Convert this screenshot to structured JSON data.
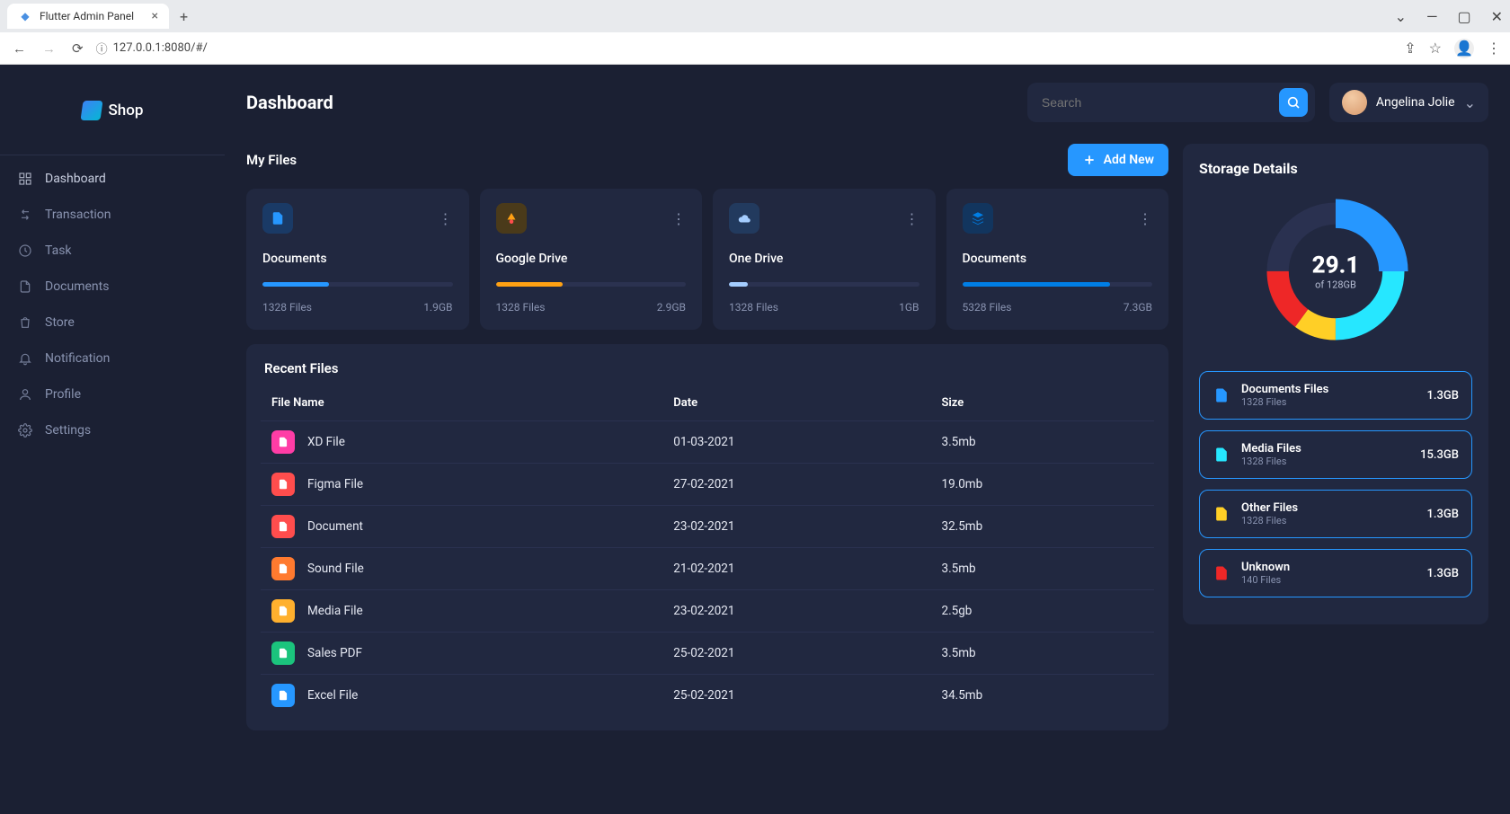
{
  "browser": {
    "tab_title": "Flutter Admin Panel",
    "url": "127.0.0.1:8080/#/"
  },
  "brand": "Shop",
  "nav": [
    {
      "label": "Dashboard",
      "icon": "grid"
    },
    {
      "label": "Transaction",
      "icon": "swap"
    },
    {
      "label": "Task",
      "icon": "clock"
    },
    {
      "label": "Documents",
      "icon": "file"
    },
    {
      "label": "Store",
      "icon": "bag"
    },
    {
      "label": "Notification",
      "icon": "bell"
    },
    {
      "label": "Profile",
      "icon": "user"
    },
    {
      "label": "Settings",
      "icon": "gear"
    }
  ],
  "header": {
    "title": "Dashboard",
    "search_placeholder": "Search",
    "user": "Angelina Jolie"
  },
  "myfiles": {
    "title": "My Files",
    "add_label": "Add New",
    "cards": [
      {
        "title": "Documents",
        "files": "1328 Files",
        "size": "1.9GB",
        "progress": 35,
        "color": "#2697ff",
        "bg": "#1a3a66"
      },
      {
        "title": "Google Drive",
        "files": "1328 Files",
        "size": "2.9GB",
        "progress": 35,
        "color": "#ffa113",
        "bg": "#4a3a1a"
      },
      {
        "title": "One Drive",
        "files": "1328 Files",
        "size": "1GB",
        "progress": 10,
        "color": "#a4cdff",
        "bg": "#223a5e"
      },
      {
        "title": "Documents",
        "files": "5328 Files",
        "size": "7.3GB",
        "progress": 78,
        "color": "#007ee5",
        "bg": "#12355e"
      }
    ]
  },
  "recent": {
    "title": "Recent Files",
    "headers": [
      "File Name",
      "Date",
      "Size"
    ],
    "rows": [
      {
        "name": "XD File",
        "date": "01-03-2021",
        "size": "3.5mb",
        "color": "#ff3da6"
      },
      {
        "name": "Figma File",
        "date": "27-02-2021",
        "size": "19.0mb",
        "color": "#ff4d4d"
      },
      {
        "name": "Document",
        "date": "23-02-2021",
        "size": "32.5mb",
        "color": "#ff4d4d"
      },
      {
        "name": "Sound File",
        "date": "21-02-2021",
        "size": "3.5mb",
        "color": "#ff7a2f"
      },
      {
        "name": "Media File",
        "date": "23-02-2021",
        "size": "2.5gb",
        "color": "#ffb02e"
      },
      {
        "name": "Sales PDF",
        "date": "25-02-2021",
        "size": "3.5mb",
        "color": "#1bc47d"
      },
      {
        "name": "Excel File",
        "date": "25-02-2021",
        "size": "34.5mb",
        "color": "#2697ff"
      }
    ]
  },
  "storage": {
    "title": "Storage Details",
    "center_value": "29.1",
    "center_sub": "of 128GB",
    "items": [
      {
        "name": "Documents Files",
        "count": "1328 Files",
        "size": "1.3GB",
        "color": "#2697ff"
      },
      {
        "name": "Media Files",
        "count": "1328 Files",
        "size": "15.3GB",
        "color": "#26e7ff"
      },
      {
        "name": "Other Files",
        "count": "1328 Files",
        "size": "1.3GB",
        "color": "#ffcf26"
      },
      {
        "name": "Unknown",
        "count": "140 Files",
        "size": "1.3GB",
        "color": "#ee2727"
      }
    ]
  },
  "chart_data": {
    "type": "pie",
    "title": "Storage Details",
    "series": [
      {
        "name": "Documents Files",
        "value": 25,
        "color": "#2697ff"
      },
      {
        "name": "Media Files",
        "value": 25,
        "color": "#26e7ff"
      },
      {
        "name": "Other Files",
        "value": 10,
        "color": "#ffcf26"
      },
      {
        "name": "Unknown",
        "value": 15,
        "color": "#ee2727"
      },
      {
        "name": "Free",
        "value": 25,
        "color": "#2a3150"
      }
    ],
    "center_value": 29.1,
    "center_label": "of 128GB"
  }
}
